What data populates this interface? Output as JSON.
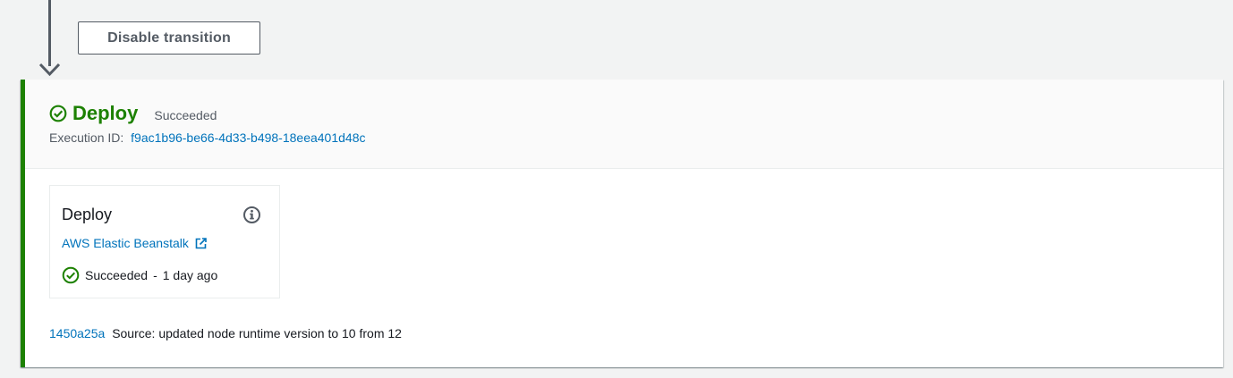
{
  "transition": {
    "disable_label": "Disable transition"
  },
  "stage": {
    "name": "Deploy",
    "status": "Succeeded",
    "execution_id_label": "Execution ID:",
    "execution_id": "f9ac1b96-be66-4d33-b498-18eea401d48c",
    "status_color": "#1d8102"
  },
  "action": {
    "name": "Deploy",
    "provider": "AWS Elastic Beanstalk",
    "status": "Succeeded",
    "separator": "-",
    "time_ago": "1 day ago"
  },
  "commit": {
    "id": "1450a25a",
    "message": "Source: updated node runtime version to 10 from 12"
  },
  "icons": {
    "stage_status": "check-circle-icon",
    "info": "info-icon",
    "external_link": "external-link-icon",
    "action_status": "check-circle-icon",
    "transition_arrow": "arrow-down-icon"
  },
  "colors": {
    "success": "#1d8102",
    "link": "#0073bb",
    "text_secondary": "#545b64"
  }
}
